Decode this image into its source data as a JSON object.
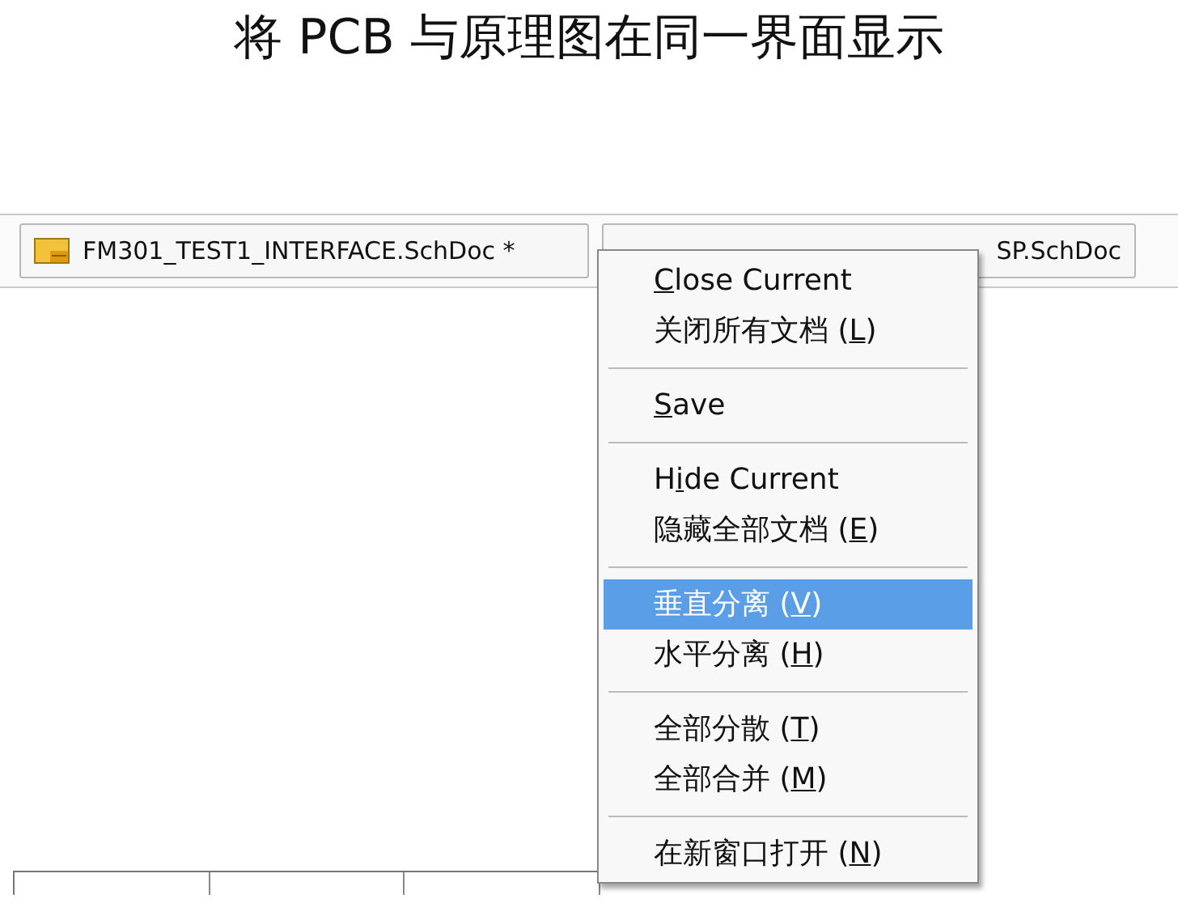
{
  "heading": "将 PCB 与原理图在同一界面显示",
  "tabs": [
    {
      "label": "FM301_TEST1_INTERFACE.SchDoc *"
    },
    {
      "label": "SP.SchDoc"
    }
  ],
  "context_menu": {
    "groups": [
      [
        {
          "key": "C",
          "post": "lose Current",
          "selected": false
        },
        {
          "pre": "关闭所有文档 (",
          "key": "L",
          "post": ")",
          "selected": false
        }
      ],
      [
        {
          "key": "S",
          "post": "ave",
          "selected": false
        }
      ],
      [
        {
          "pre": "H",
          "key": "i",
          "post": "de Current",
          "selected": false
        },
        {
          "pre": "隐藏全部文档 (",
          "key": "E",
          "post": ")",
          "selected": false
        }
      ],
      [
        {
          "pre": "垂直分离 (",
          "key": "V",
          "post": ")",
          "selected": true
        },
        {
          "pre": "水平分离 (",
          "key": "H",
          "post": ")",
          "selected": false
        }
      ],
      [
        {
          "pre": "全部分散 (",
          "key": "T",
          "post": ")",
          "selected": false
        },
        {
          "pre": "全部合并 (",
          "key": "M",
          "post": ")",
          "selected": false
        }
      ],
      [
        {
          "pre": "在新窗口打开 (",
          "key": "N",
          "post": ")",
          "selected": false
        }
      ]
    ]
  }
}
